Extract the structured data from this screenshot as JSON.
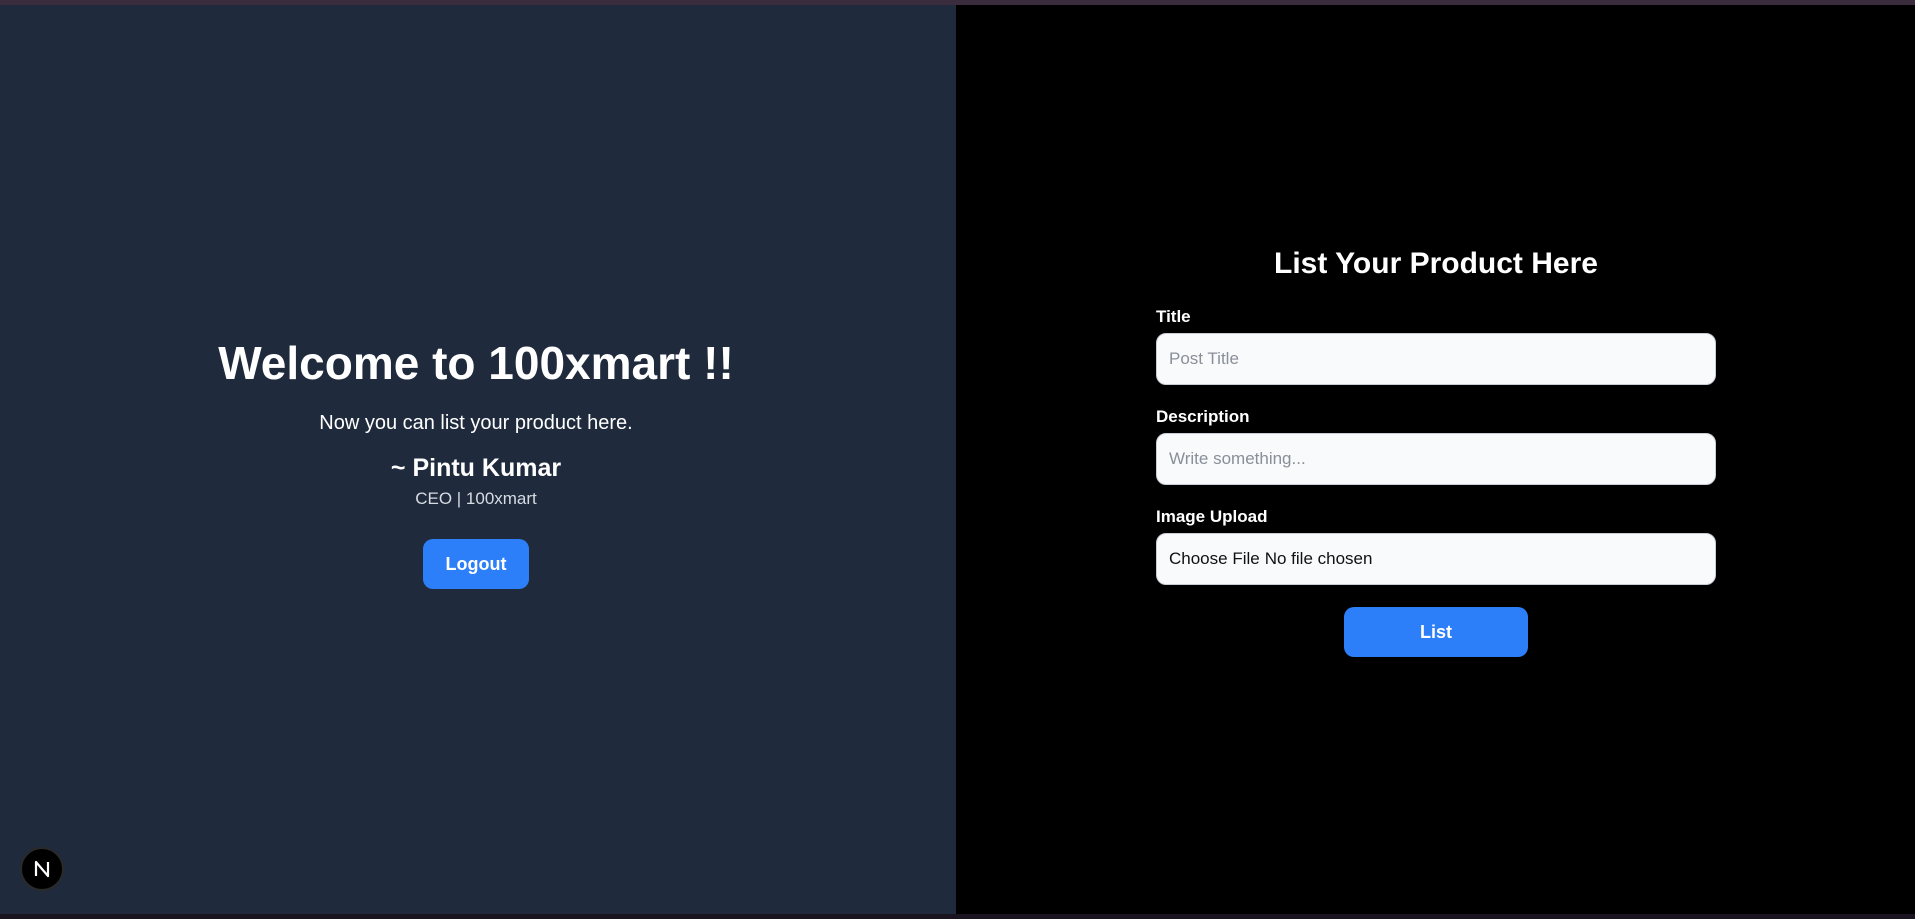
{
  "welcome": {
    "title": "Welcome to 100xmart !!",
    "subtitle": "Now you can list your product here.",
    "signature": "~ Pintu Kumar",
    "role": "CEO | 100xmart",
    "logout_label": "Logout"
  },
  "dev_badge": {
    "letter": "N",
    "icon": "nextjs-logo-icon"
  },
  "form": {
    "heading": "List Your Product Here",
    "title_label": "Title",
    "title_placeholder": "Post Title",
    "description_label": "Description",
    "description_placeholder": "Write something...",
    "image_label": "Image Upload",
    "file_button": "Choose File",
    "file_status": "No file chosen",
    "submit_label": "List"
  },
  "colors": {
    "left_panel_bg": "#1f2a3c",
    "right_panel_bg": "#000000",
    "accent_button": "#2d7ff9",
    "input_bg": "#f8fafc"
  }
}
